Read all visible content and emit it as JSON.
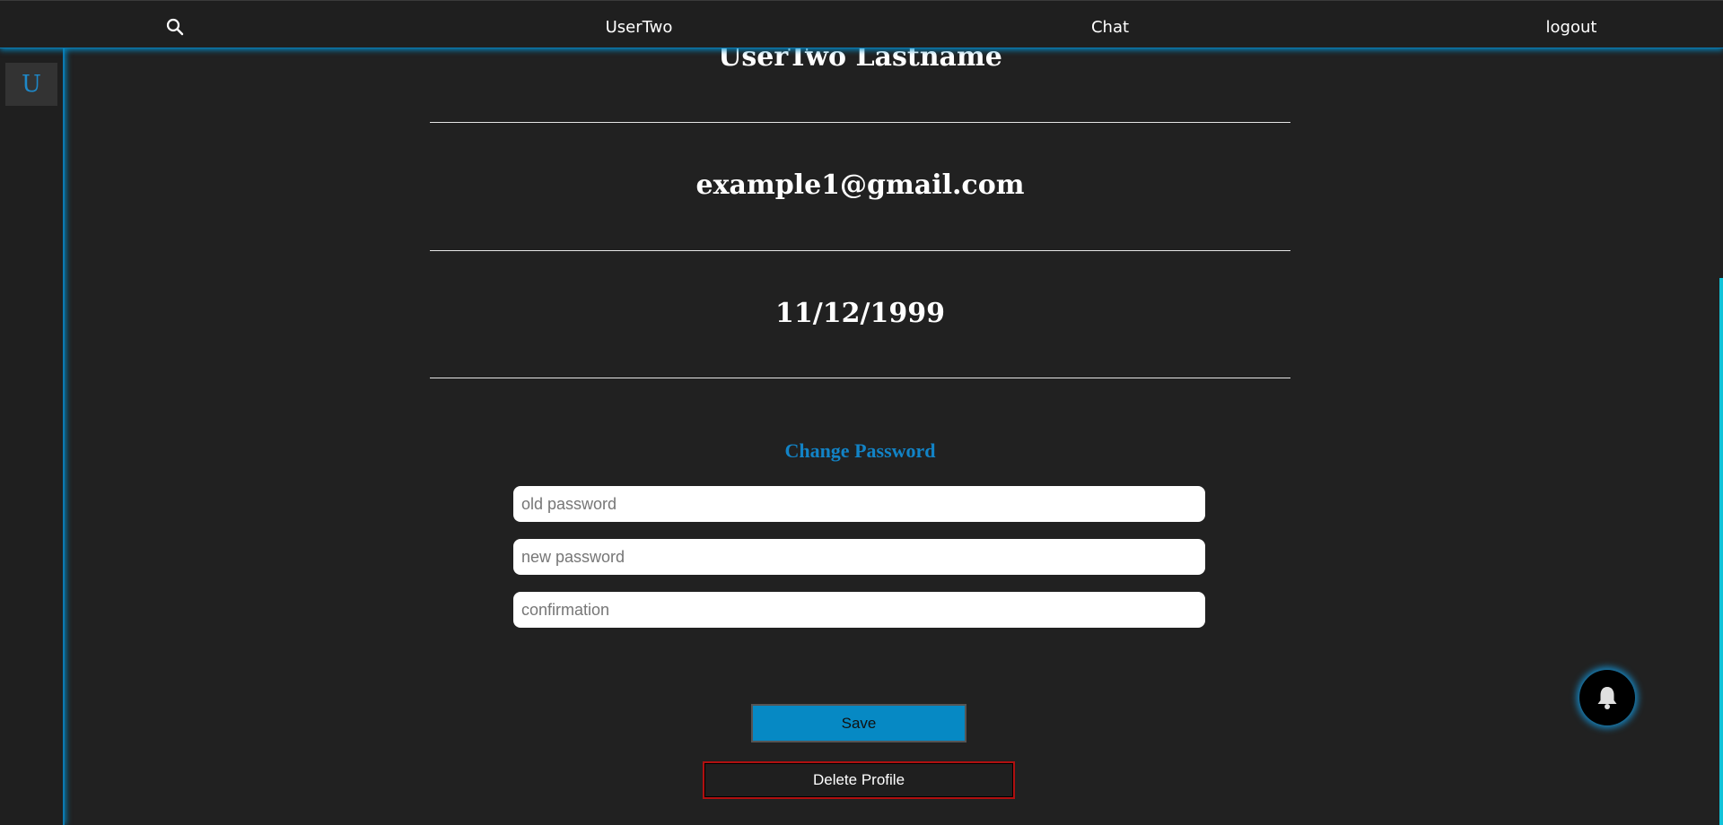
{
  "nav": {
    "username": "UserTwo",
    "chat_label": "Chat",
    "logout_label": "logout",
    "search_icon": "search-icon"
  },
  "sidebar": {
    "avatar_initial": "U"
  },
  "profile": {
    "full_name": "UserTwo Lastname",
    "email": "example1@gmail.com",
    "birthdate": "11/12/1999"
  },
  "change_password": {
    "title": "Change Password",
    "old_placeholder": "old password",
    "new_placeholder": "new password",
    "confirm_placeholder": "confirmation",
    "save_label": "Save",
    "delete_label": "Delete Profile"
  },
  "notifications": {
    "icon": "bell-icon"
  },
  "colors": {
    "accent": "#0689c4",
    "danger": "#b01010",
    "background": "#212121"
  }
}
